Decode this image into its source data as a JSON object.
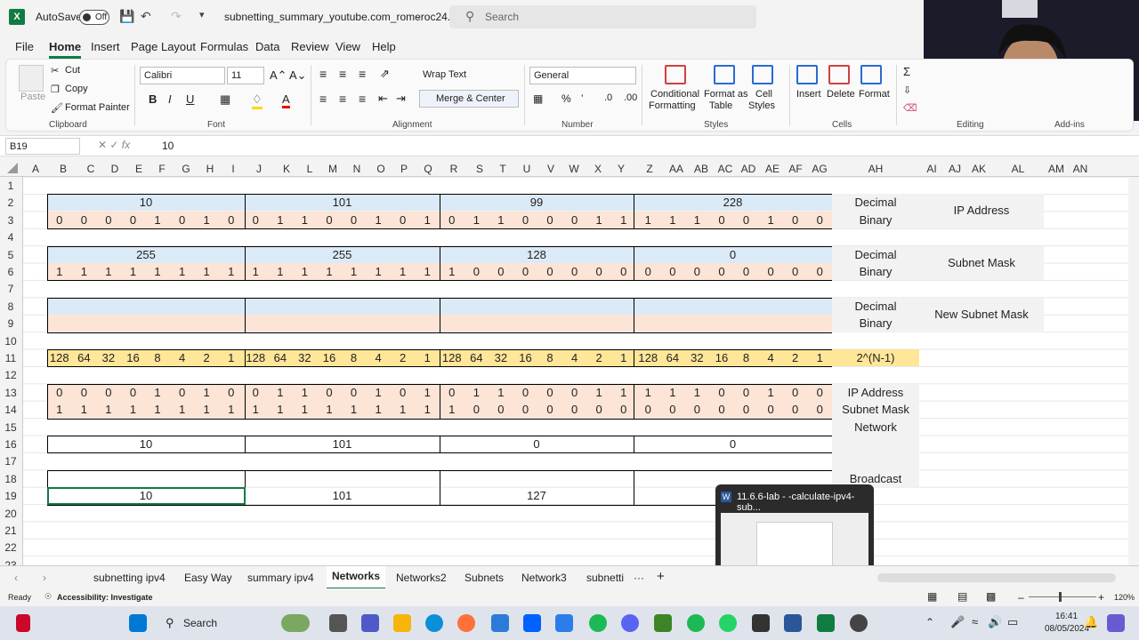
{
  "titlebar": {
    "autosave": "AutoSave",
    "toggle": "Off",
    "filename": "subnetting_summary_youtube.com_romeroc24....",
    "search": "Search"
  },
  "menu": [
    "File",
    "Home",
    "Insert",
    "Page Layout",
    "Formulas",
    "Data",
    "Review",
    "View",
    "Help"
  ],
  "ribbon": {
    "cut": "Cut",
    "copy": "Copy",
    "format_painter": "Format Painter",
    "paste": "Paste",
    "clipboard": "Clipboard",
    "font_name": "Calibri",
    "font_size": "11",
    "font": "Font",
    "wrap": "Wrap Text",
    "merge": "Merge & Center",
    "alignment": "Alignment",
    "number_format": "General",
    "number": "Number",
    "cond": "Conditional",
    "cond2": "Formatting",
    "fmt_table": "Format as",
    "fmt_table2": "Table",
    "cell_styles": "Cell",
    "cell_styles2": "Styles",
    "styles": "Styles",
    "insert": "Insert",
    "delete": "Delete",
    "format": "Format",
    "cells": "Cells",
    "editing": "Editing",
    "addins": "Add-ins"
  },
  "formula": {
    "namebox": "B19",
    "value": "10"
  },
  "columns": [
    "A",
    "B",
    "C",
    "D",
    "E",
    "F",
    "G",
    "H",
    "I",
    "J",
    "K",
    "L",
    "M",
    "N",
    "O",
    "P",
    "Q",
    "R",
    "S",
    "T",
    "U",
    "V",
    "W",
    "X",
    "Y",
    "Z",
    "AA",
    "AB",
    "AC",
    "AD",
    "AE",
    "AF",
    "AG",
    "AH",
    "AI",
    "AJ",
    "AK",
    "AL",
    "AM",
    "AN"
  ],
  "rows": [
    "1",
    "2",
    "3",
    "4",
    "5",
    "6",
    "7",
    "8",
    "9",
    "10",
    "11",
    "12",
    "13",
    "14",
    "15",
    "16",
    "17",
    "18",
    "19",
    "20",
    "21",
    "22",
    "23"
  ],
  "sheet": {
    "ip_dec": [
      "10",
      "101",
      "99",
      "228"
    ],
    "ip_bin": [
      "0",
      "0",
      "0",
      "0",
      "1",
      "0",
      "1",
      "0",
      "0",
      "1",
      "1",
      "0",
      "0",
      "1",
      "0",
      "1",
      "0",
      "1",
      "1",
      "0",
      "0",
      "0",
      "1",
      "1",
      "1",
      "1",
      "1",
      "0",
      "0",
      "1",
      "0",
      "0"
    ],
    "mask_dec": [
      "255",
      "255",
      "128",
      "0"
    ],
    "mask_bin": [
      "1",
      "1",
      "1",
      "1",
      "1",
      "1",
      "1",
      "1",
      "1",
      "1",
      "1",
      "1",
      "1",
      "1",
      "1",
      "1",
      "1",
      "0",
      "0",
      "0",
      "0",
      "0",
      "0",
      "0",
      "0",
      "0",
      "0",
      "0",
      "0",
      "0",
      "0",
      "0"
    ],
    "powers": [
      "128",
      "64",
      "32",
      "16",
      "8",
      "4",
      "2",
      "1",
      "128",
      "64",
      "32",
      "16",
      "8",
      "4",
      "2",
      "1",
      "128",
      "64",
      "32",
      "16",
      "8",
      "4",
      "2",
      "1",
      "128",
      "64",
      "32",
      "16",
      "8",
      "4",
      "2",
      "1"
    ],
    "network_dec": [
      "10",
      "101",
      "0",
      "0"
    ],
    "row19_dec": [
      "10",
      "101",
      "127"
    ],
    "lbl_decimal": "Decimal",
    "lbl_binary": "Binary",
    "lbl_ip": "IP Address",
    "lbl_mask": "Subnet Mask",
    "lbl_new_mask": "New Subnet Mask",
    "lbl_power": "2^(N-1)",
    "lbl_ip2": "IP Address",
    "lbl_mask2": "Subnet Mask",
    "lbl_network": "Network",
    "lbl_broadcast": "Broadcast"
  },
  "tabs": [
    "subnetting ipv4",
    "Easy Way",
    "summary ipv4",
    "Networks",
    "Networks2",
    "Subnets",
    "Network3",
    "subnetti"
  ],
  "status": {
    "ready": "Ready",
    "accessibility": "Accessibility: Investigate",
    "zoom": "120%"
  },
  "taskbar": {
    "search": "Search",
    "time": "16:41",
    "date": "08/05/2024"
  },
  "popup": {
    "title": "11.6.6-lab - -calculate-ipv4-sub..."
  }
}
